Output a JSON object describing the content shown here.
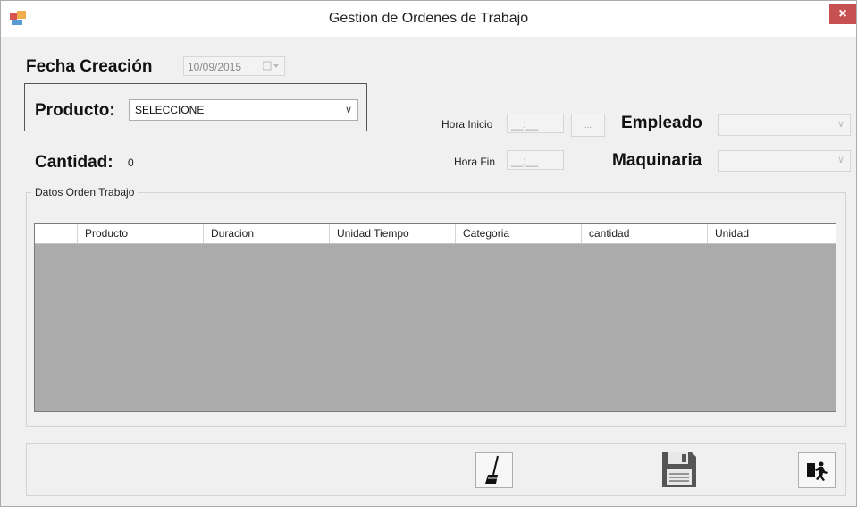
{
  "window": {
    "title": "Gestion de Ordenes de Trabajo",
    "close_glyph": "×"
  },
  "form": {
    "fecha_creacion_label": "Fecha Creación",
    "fecha_creacion_value": "10/09/2015",
    "producto_label": "Producto:",
    "producto_value": "SELECCIONE",
    "cantidad_label": "Cantidad:",
    "cantidad_value": "0",
    "hora_inicio_label": "Hora Inicio",
    "hora_inicio_mask": "__:__",
    "hora_fin_label": "Hora Fin",
    "hora_fin_mask": "__:__",
    "dots_label": "...",
    "empleado_label": "Empleado",
    "maquinaria_label": "Maquinaria"
  },
  "group": {
    "title": "Datos Orden Trabajo"
  },
  "grid": {
    "columns": [
      "Producto",
      "Duracion",
      "Unidad Tiempo",
      "Categoria",
      "cantidad",
      "Unidad"
    ]
  },
  "icons": {
    "app": "app-window-icon",
    "clear": "broom-icon",
    "save": "floppy-disk-icon",
    "exit": "exit-door-icon"
  },
  "colors": {
    "close_button": "#c75050",
    "grid_background": "#ababab",
    "window_background": "#f0f0f0"
  }
}
